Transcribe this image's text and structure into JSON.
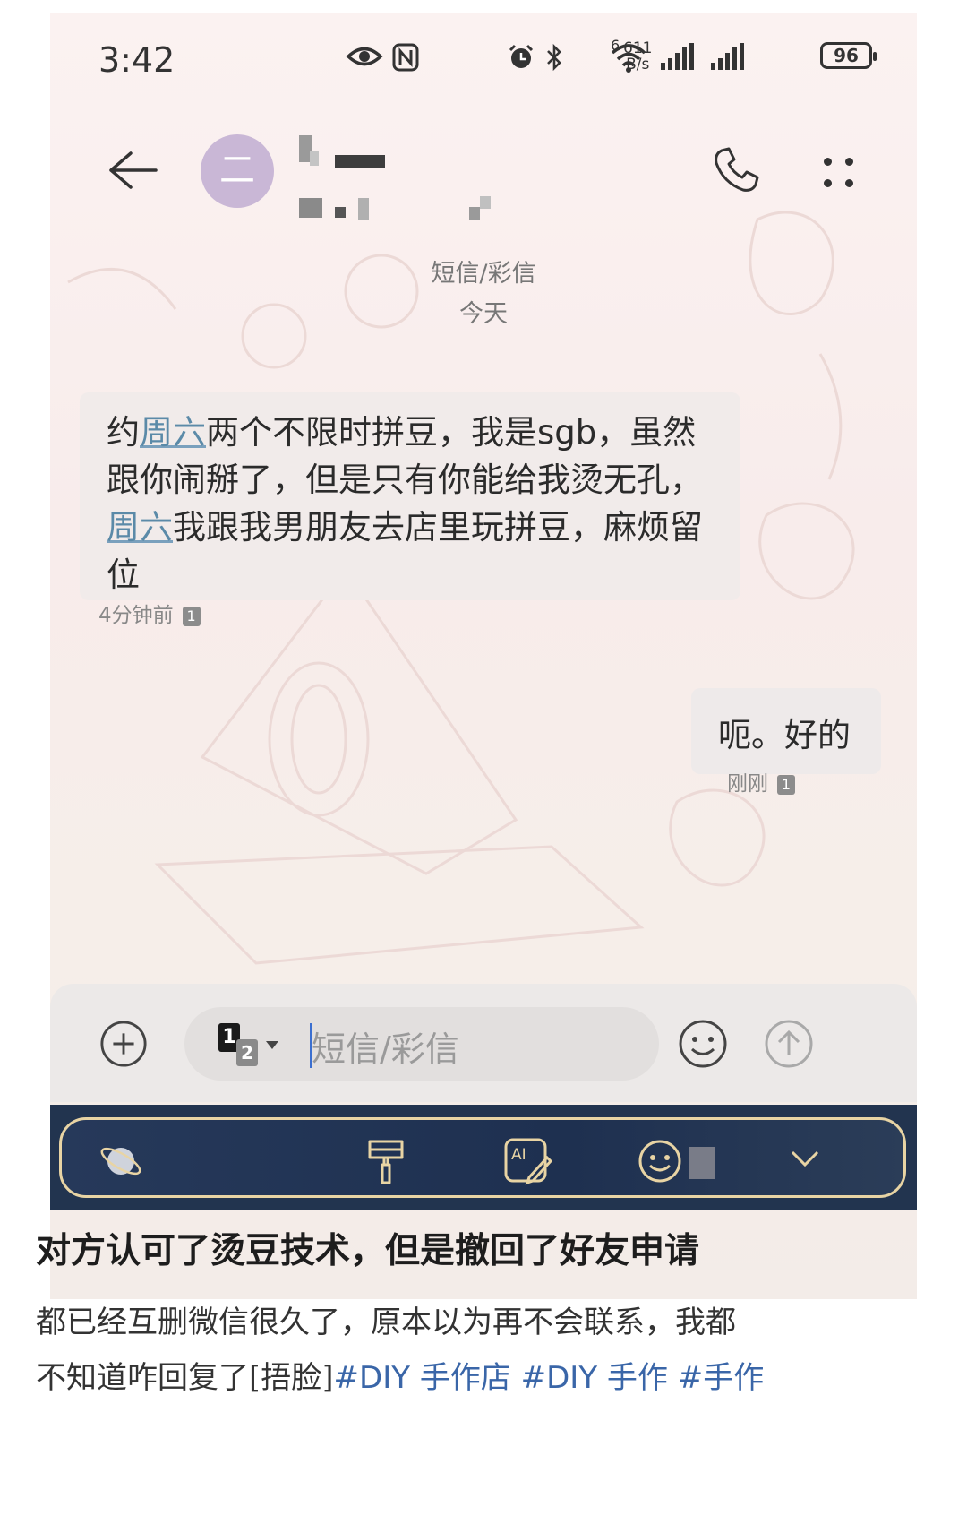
{
  "status_bar": {
    "time": "3:42",
    "net_speed_value": "611",
    "net_speed_unit": "B/s",
    "wifi_label": "6",
    "battery": "96"
  },
  "header": {
    "avatar_letter": "二"
  },
  "thread": {
    "channel_label": "短信/彩信",
    "date_label": "今天"
  },
  "messages": [
    {
      "direction": "incoming",
      "parts": [
        {
          "text": "约",
          "link": false
        },
        {
          "text": "周六",
          "link": true
        },
        {
          "text": "两个不限时拼豆，我是sgb，虽然跟你闹掰了，但是只有你能给我烫无孔，",
          "link": false
        },
        {
          "text": "周六",
          "link": true
        },
        {
          "text": "我跟我男朋友去店里玩拼豆，麻烦留位",
          "link": false
        }
      ],
      "time": "4分钟前",
      "sim": "1"
    },
    {
      "direction": "outgoing",
      "text": "呃。好的",
      "time": "刚刚",
      "sim": "1"
    }
  ],
  "composer": {
    "sim_primary": "1",
    "sim_secondary": "2",
    "placeholder": "短信/彩信"
  },
  "post": {
    "title": "对方认可了烫豆技术，但是撤回了好友申请",
    "body_line1": "都已经互删微信很久了，原本以为再不会联系，我都",
    "body_line2_plain": "不知道咋回复了[捂脸]",
    "tags": [
      "#DIY 手作店",
      "#DIY 手作",
      "#手作"
    ]
  },
  "colors": {
    "link": "#5b8aa8",
    "keyboard_bg": "#22344f",
    "keyboard_accent": "#e8d4a4",
    "avatar_bg": "#c9b7d6",
    "caret": "#3b6fd0"
  }
}
